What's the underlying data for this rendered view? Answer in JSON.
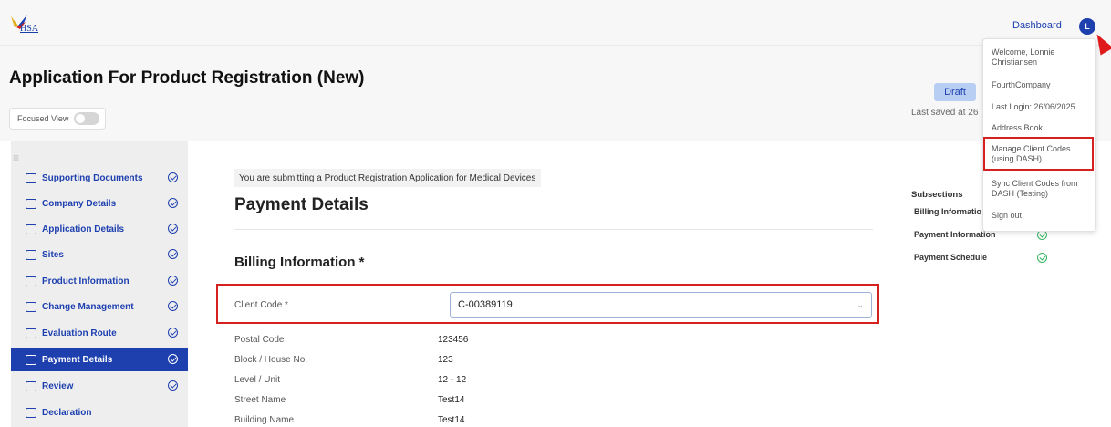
{
  "brand": {
    "logo_text": "HSA"
  },
  "topbar": {
    "dashboard_label": "Dashboard",
    "avatar_initial": "L"
  },
  "header": {
    "title": "Application For Product Registration (New)",
    "focused_view_label": "Focused View",
    "status_badge": "Draft",
    "last_saved": "Last saved at 26"
  },
  "sidebar": {
    "items": [
      {
        "label": "Supporting Documents",
        "icon": "folder-icon",
        "checked": true
      },
      {
        "label": "Company Details",
        "icon": "building-icon",
        "checked": true
      },
      {
        "label": "Application Details",
        "icon": "documents-icon",
        "checked": true
      },
      {
        "label": "Sites",
        "icon": "sites-icon",
        "checked": true
      },
      {
        "label": "Product Information",
        "icon": "box-icon",
        "checked": true
      },
      {
        "label": "Change Management",
        "icon": "edit-icon",
        "checked": true
      },
      {
        "label": "Evaluation Route",
        "icon": "check-circle-icon",
        "checked": true
      },
      {
        "label": "Payment Details",
        "icon": "card-icon",
        "checked": true,
        "active": true
      },
      {
        "label": "Review",
        "icon": "review-icon",
        "checked": true
      },
      {
        "label": "Declaration",
        "icon": "declaration-icon",
        "checked": false
      }
    ]
  },
  "main": {
    "banner": "You are submitting a Product Registration Application for Medical Devices",
    "heading": "Payment Details",
    "section_title": "Billing Information *",
    "client_code": {
      "label": "Client Code *",
      "value": "C-00389119"
    },
    "fields": [
      {
        "label": "Postal Code",
        "value": "123456"
      },
      {
        "label": "Block / House No.",
        "value": "123"
      },
      {
        "label": "Level / Unit",
        "value": "12 - 12"
      },
      {
        "label": "Street Name",
        "value": "Test14"
      },
      {
        "label": "Building Name",
        "value": "Test14"
      }
    ]
  },
  "subsections": {
    "title": "Subsections",
    "items": [
      {
        "label": "Billing Informatio"
      },
      {
        "label": "Payment Information"
      },
      {
        "label": "Payment Schedule"
      }
    ]
  },
  "user_menu": {
    "welcome": "Welcome, Lonnie Christiansen",
    "company": "FourthCompany",
    "last_login": "Last Login: 26/06/2025",
    "address_book": "Address Book",
    "manage_client_codes": "Manage Client Codes (using DASH)",
    "sync_client_codes": "Sync Client Codes from DASH (Testing)",
    "sign_out": "Sign out"
  },
  "colors": {
    "primary": "#1e40af",
    "highlight": "#d62121",
    "success": "#35b35f"
  }
}
